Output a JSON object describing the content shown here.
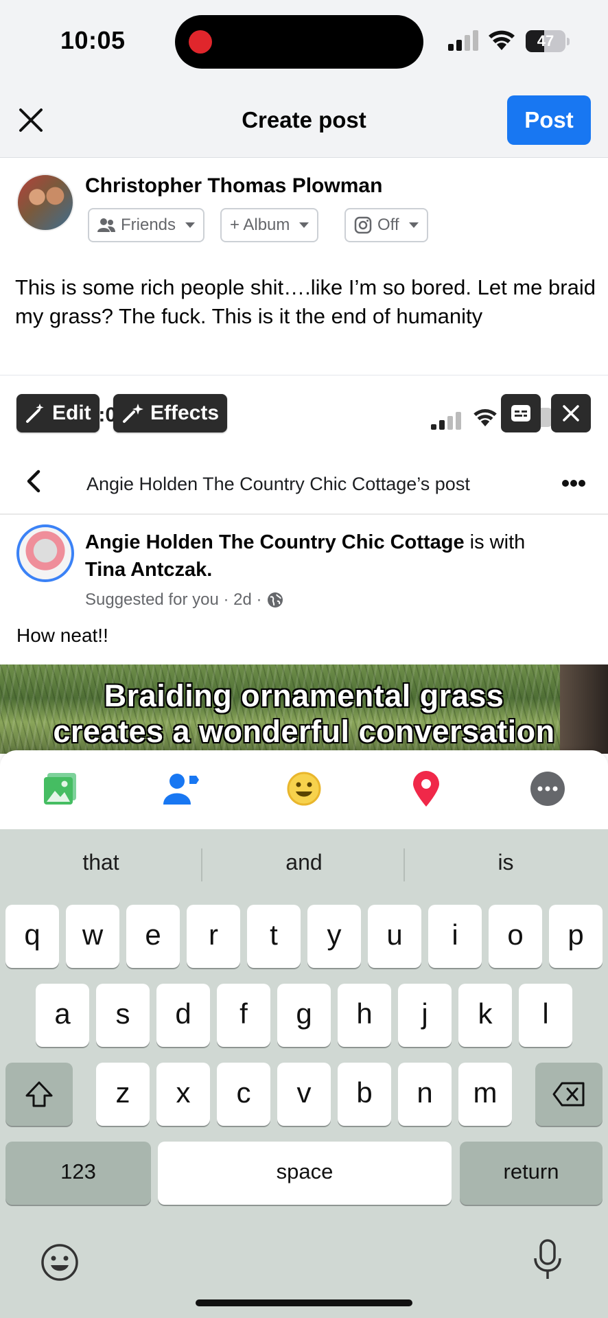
{
  "status_bar": {
    "time": "10:05",
    "battery": "47",
    "battery_level": 0.47
  },
  "header": {
    "close_icon": "close-icon",
    "title": "Create post",
    "post_label": "Post",
    "accent": "#1877f2"
  },
  "composer": {
    "user_name": "Christopher Thomas Plowman",
    "audience": "Friends",
    "album": "+ Album",
    "instagram": "Off",
    "text": "This is some rich people shit….like I’m so bored. Let me braid my grass? The fuck. This is it the end of humanity"
  },
  "media_tools": {
    "edit": "Edit",
    "effects": "Effects"
  },
  "embedded": {
    "time": "10:05",
    "title": "Angie Holden The Country Chic Cottage’s post",
    "page_name": "Angie Holden The Country Chic Cottage",
    "with_text": " is with",
    "tagged": "Tina Antczak.",
    "meta": "Suggested for you · 2d ·",
    "caption": "How neat!!",
    "overlay_line1": "Braiding ornamental grass",
    "overlay_line2": "creates a wonderful conversation"
  },
  "attachments": [
    "photo-icon",
    "tag-people-icon",
    "feeling-icon",
    "location-icon",
    "more-icon"
  ],
  "keyboard": {
    "suggestions": [
      "that",
      "and",
      "is"
    ],
    "row1": [
      "q",
      "w",
      "e",
      "r",
      "t",
      "y",
      "u",
      "i",
      "o",
      "p"
    ],
    "row2": [
      "a",
      "s",
      "d",
      "f",
      "g",
      "h",
      "j",
      "k",
      "l"
    ],
    "row3": [
      "z",
      "x",
      "c",
      "v",
      "b",
      "n",
      "m"
    ],
    "numbers": "123",
    "space": "space",
    "return": "return"
  }
}
